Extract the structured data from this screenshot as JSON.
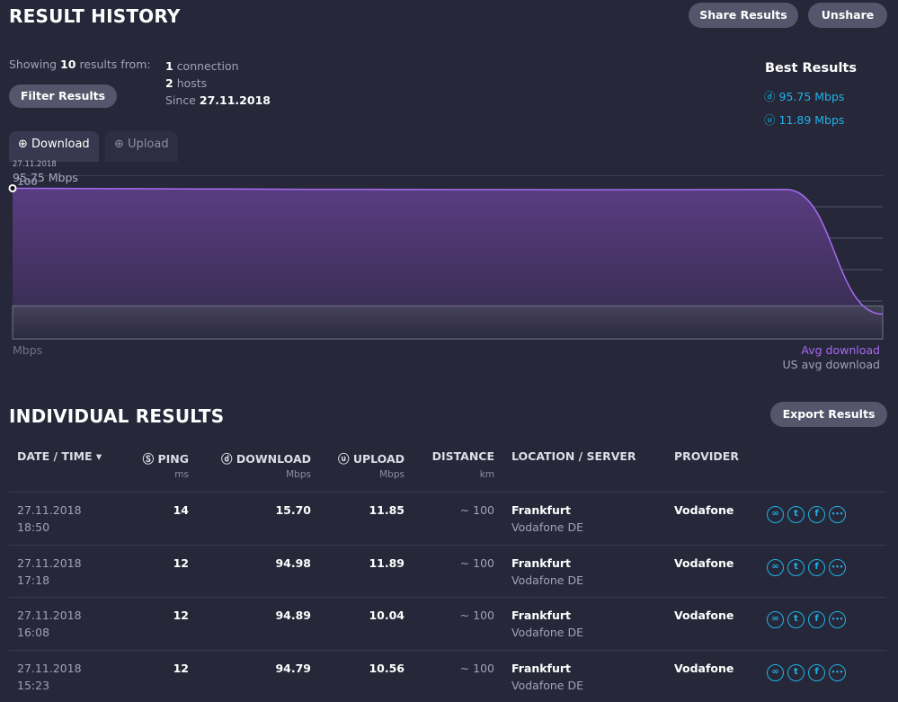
{
  "header": {
    "title": "RESULT HISTORY",
    "share_label": "Share Results",
    "unshare_label": "Unshare"
  },
  "summary": {
    "showing_prefix": "Showing",
    "count": "10",
    "showing_suffix": "results from:",
    "connections_count": "1",
    "connections_label": "connection",
    "hosts_count": "2",
    "hosts_label": "hosts",
    "since_label": "Since",
    "since_date": "27.11.2018",
    "filter_label": "Filter Results"
  },
  "best": {
    "title": "Best Results",
    "download": "95.75 Mbps",
    "upload": "11.89 Mbps"
  },
  "tabs": [
    {
      "label": "Download",
      "active": true
    },
    {
      "label": "Upload",
      "active": false
    }
  ],
  "colors": {
    "accent": "#1fb3e8",
    "download_line": "#a66cf0",
    "background": "#262738"
  },
  "chart_data": {
    "type": "area",
    "tooltip_date": "27.11.2018",
    "tooltip_value": "95.75 Mbps",
    "ylabel": "Mbps",
    "ylim": [
      0,
      100
    ],
    "yticks": [
      20,
      40,
      60,
      80,
      100
    ],
    "series": [
      {
        "name": "Avg download",
        "values": [
          95.75,
          95.5,
          95.3,
          95.1,
          95.0,
          94.9,
          94.79,
          94.89,
          94.98,
          15.7
        ]
      },
      {
        "name": "US avg download",
        "values": [
          21,
          21,
          21,
          21,
          21,
          21,
          21,
          21,
          21,
          21
        ]
      }
    ]
  },
  "individual": {
    "title": "INDIVIDUAL RESULTS",
    "export_label": "Export Results",
    "columns": [
      {
        "label": "DATE / TIME ▾",
        "unit": ""
      },
      {
        "label": "PING",
        "unit": "ms"
      },
      {
        "label": "DOWNLOAD",
        "unit": "Mbps"
      },
      {
        "label": "UPLOAD",
        "unit": "Mbps"
      },
      {
        "label": "DISTANCE",
        "unit": "km"
      },
      {
        "label": "LOCATION / SERVER",
        "unit": ""
      },
      {
        "label": "PROVIDER",
        "unit": ""
      }
    ],
    "rows": [
      {
        "date": "27.11.2018",
        "time": "18:50",
        "ping": "14",
        "download": "15.70",
        "upload": "11.85",
        "distance": "~ 100",
        "location": "Frankfurt",
        "server": "Vodafone DE",
        "provider": "Vodafone"
      },
      {
        "date": "27.11.2018",
        "time": "17:18",
        "ping": "12",
        "download": "94.98",
        "upload": "11.89",
        "distance": "~ 100",
        "location": "Frankfurt",
        "server": "Vodafone DE",
        "provider": "Vodafone"
      },
      {
        "date": "27.11.2018",
        "time": "16:08",
        "ping": "12",
        "download": "94.89",
        "upload": "10.04",
        "distance": "~ 100",
        "location": "Frankfurt",
        "server": "Vodafone DE",
        "provider": "Vodafone"
      },
      {
        "date": "27.11.2018",
        "time": "15:23",
        "ping": "12",
        "download": "94.79",
        "upload": "10.56",
        "distance": "~ 100",
        "location": "Frankfurt",
        "server": "Vodafone DE",
        "provider": "Vodafone"
      }
    ]
  }
}
